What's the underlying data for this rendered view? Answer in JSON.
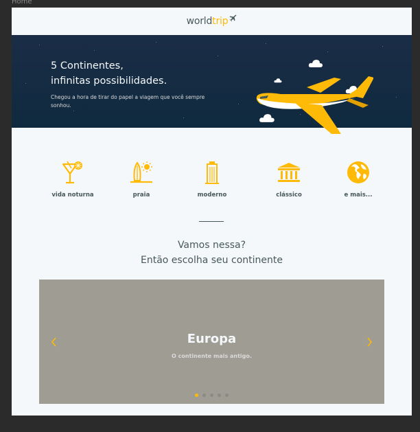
{
  "frame": {
    "label": "Home"
  },
  "header": {
    "logo_world": "world",
    "logo_trip": "trip"
  },
  "banner": {
    "title_line1": "5 Continentes,",
    "title_line2": "infinitas possibilidades.",
    "subtitle": "Chegou a hora de tirar do papel a viagem que você sempre sonhou."
  },
  "categories": [
    {
      "label": "vida noturna",
      "icon": "cocktail-icon"
    },
    {
      "label": "praia",
      "icon": "surfboard-sun-icon"
    },
    {
      "label": "moderno",
      "icon": "building-icon"
    },
    {
      "label": "clássico",
      "icon": "museum-icon"
    },
    {
      "label": "e mais...",
      "icon": "globe-icon"
    }
  ],
  "section": {
    "line1": "Vamos nessa?",
    "line2": "Então escolha seu continente"
  },
  "carousel": {
    "title": "Europa",
    "subtitle": "O continente mais antigo.",
    "slide_count": 5,
    "active_index": 0
  },
  "colors": {
    "accent": "#FFBA08",
    "dark_text": "#47585B",
    "light_bg": "#F5F8FA",
    "banner_bg": "#142B42",
    "carousel_bg": "#9F9C94"
  }
}
